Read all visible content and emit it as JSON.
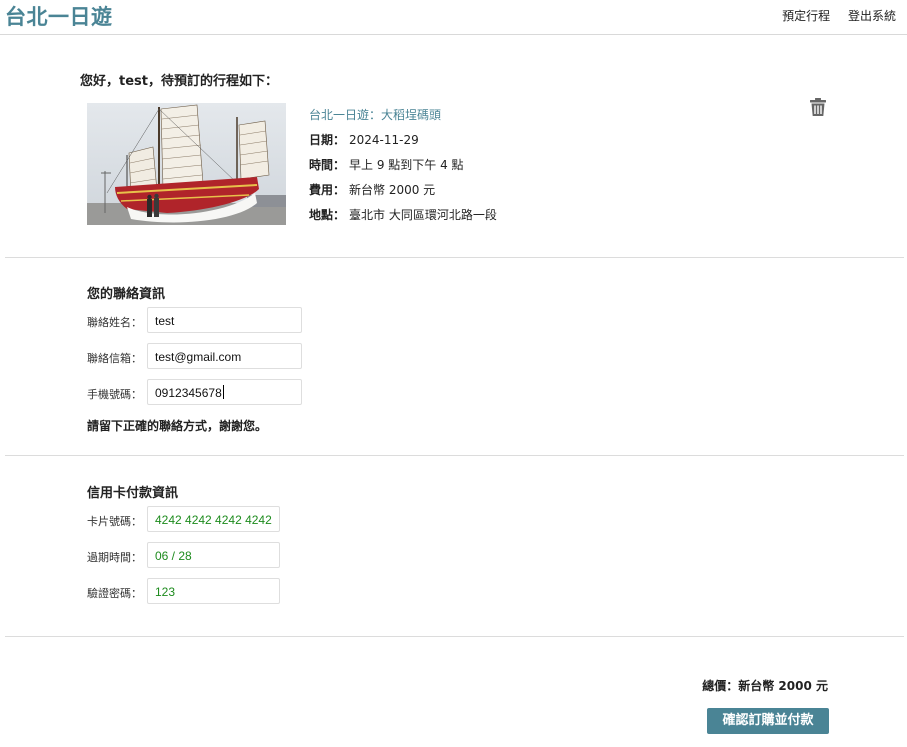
{
  "header": {
    "brand": "台北一日遊",
    "nav": {
      "reserve": "預定行程",
      "logout": "登出系統"
    }
  },
  "greeting": "您好，test，待預訂的行程如下：",
  "trip": {
    "title": "台北一日遊：大稻埕碼頭",
    "date_key": "日期：",
    "date_val": "2024-11-29",
    "time_key": "時間：",
    "time_val": "早上 9 點到下午 4 點",
    "fee_key": "費用：",
    "fee_val": "新台幣 2000 元",
    "place_key": "地點：",
    "place_val": "臺北市 大同區環河北路一段"
  },
  "contact": {
    "title": "您的聯絡資訊",
    "name_label": "聯絡姓名：",
    "name_value": "test",
    "email_label": "聯絡信箱：",
    "email_value": "test@gmail.com",
    "phone_label": "手機號碼：",
    "phone_value": "0912345678",
    "note": "請留下正確的聯絡方式，謝謝您。"
  },
  "payment": {
    "title": "信用卡付款資訊",
    "card_label": "卡片號碼：",
    "card_value": "4242 4242 4242 4242",
    "expiry_label": "過期時間：",
    "expiry_value": "06 / 28",
    "cvc_label": "驗證密碼：",
    "cvc_value": "123"
  },
  "summary": {
    "total": "總價：新台幣 2000 元",
    "confirm": "確認訂購並付款"
  },
  "colors": {
    "accent": "#4a8495",
    "card_text": "#1d8b1d"
  }
}
